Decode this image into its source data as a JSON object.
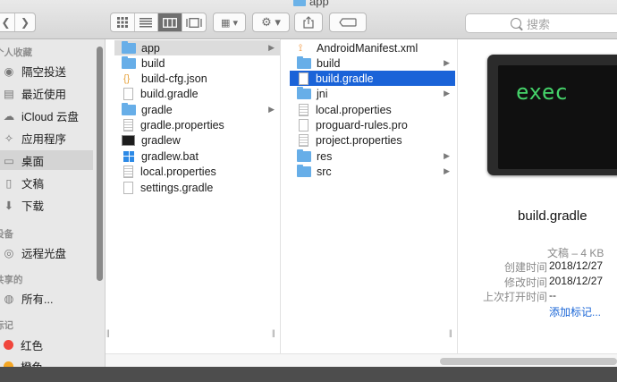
{
  "window": {
    "title": "app"
  },
  "toolbar": {
    "back_icon": "chevron-left-icon",
    "forward_icon": "chevron-right-icon",
    "view_modes": [
      "icon-view",
      "list-view",
      "column-view",
      "gallery-view"
    ],
    "active_view": "column-view",
    "search_placeholder": "搜索"
  },
  "sidebar": {
    "headers": {
      "favorites": "个人收藏",
      "devices": "设备",
      "shared": "共享的",
      "tags": "标记"
    },
    "items": [
      {
        "label": "隔空投送",
        "icon": "airdrop-icon"
      },
      {
        "label": "最近使用",
        "icon": "recents-icon"
      },
      {
        "label": "iCloud 云盘",
        "icon": "cloud-icon"
      },
      {
        "label": "应用程序",
        "icon": "applications-icon"
      },
      {
        "label": "桌面",
        "icon": "desktop-icon"
      },
      {
        "label": "文稿",
        "icon": "documents-icon"
      },
      {
        "label": "下载",
        "icon": "downloads-icon"
      },
      {
        "label": "远程光盘",
        "icon": "disc-icon"
      },
      {
        "label": "所有...",
        "icon": "network-icon"
      },
      {
        "label": "红色",
        "icon": "tag-red-icon",
        "color": "#f0463c"
      },
      {
        "label": "橙色",
        "icon": "tag-orange-icon",
        "color": "#f5a623"
      }
    ]
  },
  "columns": [
    {
      "items": [
        {
          "name": "app",
          "type": "folder",
          "has_children": true,
          "selected": "gray"
        },
        {
          "name": "build",
          "type": "folder"
        },
        {
          "name": "build-cfg.json",
          "type": "json"
        },
        {
          "name": "build.gradle",
          "type": "doc"
        },
        {
          "name": "gradle",
          "type": "folder",
          "has_children": true
        },
        {
          "name": "gradle.properties",
          "type": "doc"
        },
        {
          "name": "gradlew",
          "type": "exec"
        },
        {
          "name": "gradlew.bat",
          "type": "bat"
        },
        {
          "name": "local.properties",
          "type": "doc"
        },
        {
          "name": "settings.gradle",
          "type": "doc"
        }
      ]
    },
    {
      "items": [
        {
          "name": "AndroidManifest.xml",
          "type": "rss"
        },
        {
          "name": "build",
          "type": "folder",
          "has_children": true
        },
        {
          "name": "build.gradle",
          "type": "doc",
          "selected": "blue"
        },
        {
          "name": "jni",
          "type": "folder",
          "has_children": true
        },
        {
          "name": "local.properties",
          "type": "doc"
        },
        {
          "name": "proguard-rules.pro",
          "type": "doc"
        },
        {
          "name": "project.properties",
          "type": "doc"
        },
        {
          "name": "res",
          "type": "folder",
          "has_children": true
        },
        {
          "name": "src",
          "type": "folder",
          "has_children": true
        }
      ]
    }
  ],
  "preview": {
    "thumbnail_text": "exec",
    "file_name": "build.gradle",
    "kind": "文稿 – 4 KB",
    "created_label": "创建时间",
    "created_value": "2018/12/27",
    "modified_label": "修改时间",
    "modified_value": "2018/12/27",
    "opened_label": "上次打开时间",
    "opened_value": "--",
    "add_tags": "添加标记..."
  },
  "colors": {
    "selection_blue": "#1a63d8",
    "folder_blue": "#67aee8",
    "link_blue": "#1a66d6",
    "exec_green": "#45d46a"
  }
}
